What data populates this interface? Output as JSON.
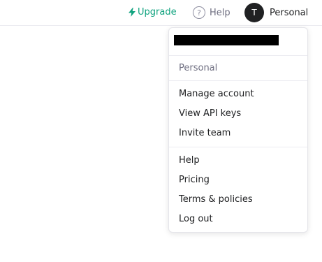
{
  "header": {
    "upgrade_label": "Upgrade",
    "help_label": "Help",
    "help_icon_glyph": "?",
    "avatar_initial": "T",
    "account_label": "Personal",
    "accent_color": "#10a37f"
  },
  "menu": {
    "org_label": "Personal",
    "account_items": [
      {
        "label": "Manage account"
      },
      {
        "label": "View API keys"
      },
      {
        "label": "Invite team"
      }
    ],
    "support_items": [
      {
        "label": "Help"
      },
      {
        "label": "Pricing"
      },
      {
        "label": "Terms & policies"
      },
      {
        "label": "Log out"
      }
    ]
  }
}
